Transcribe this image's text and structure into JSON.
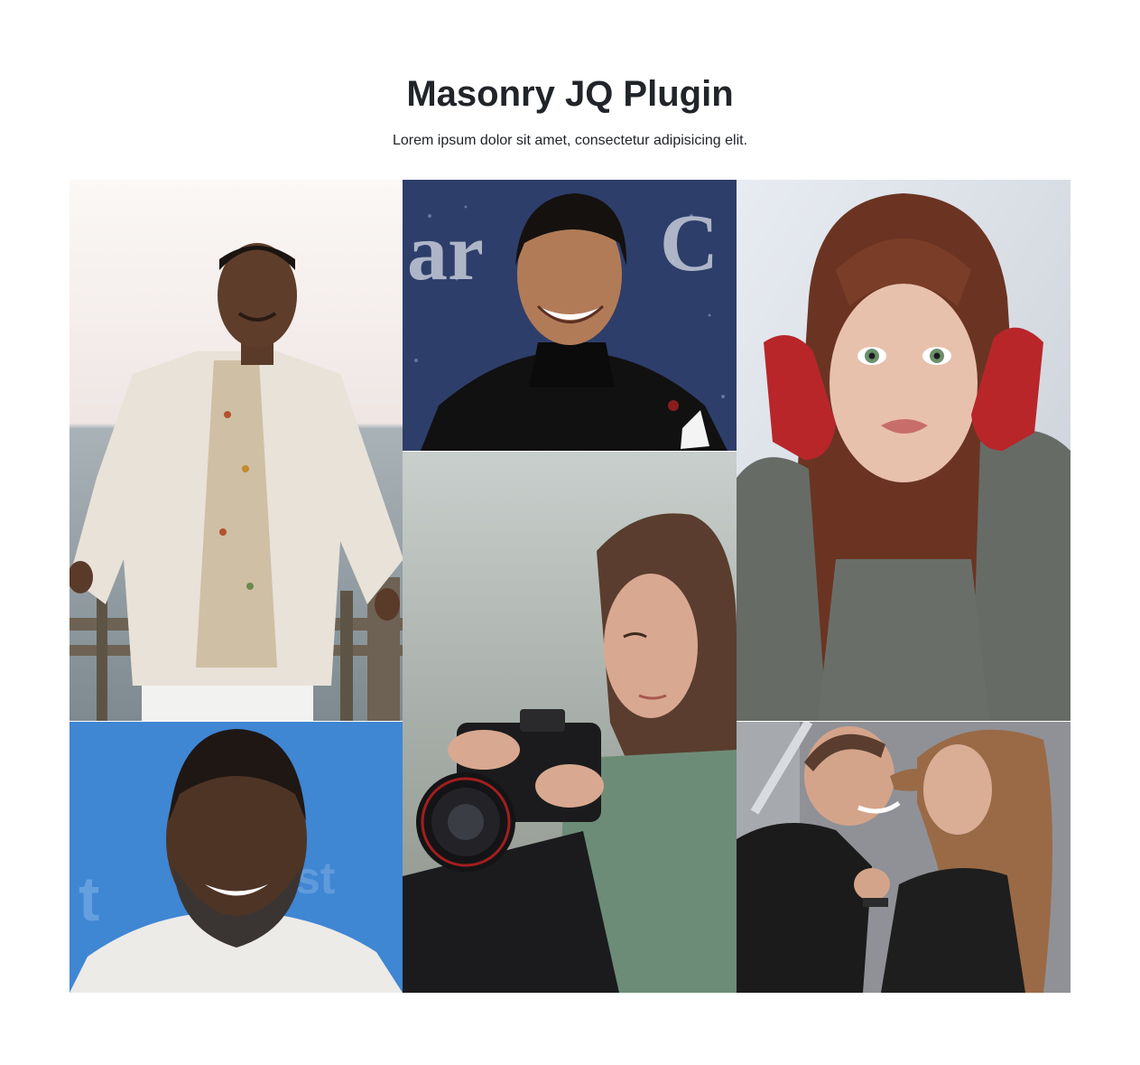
{
  "header": {
    "title": "Masonry JQ Plugin",
    "subtitle": "Lorem ipsum dolor sit amet, consectetur adipisicing elit."
  },
  "gallery": {
    "items": [
      {
        "name": "photo-man-white-suit",
        "palette": {
          "bg": "#e9e4e2",
          "sea": "#8e9aa1",
          "skin": "#5a3a29",
          "suit": "#e8e2d8",
          "shirt": "#c9b89e",
          "fence": "#6d6253"
        }
      },
      {
        "name": "photo-man-black-turtleneck",
        "palette": {
          "bg": "#2f3f6c",
          "skin": "#b07a56",
          "hair": "#1a1512",
          "jacket": "#121212"
        }
      },
      {
        "name": "photo-girl-red-gloves",
        "palette": {
          "bg": "#dfe3ea",
          "hair": "#6b3422",
          "skin": "#e8c1ad",
          "glove": "#b8262a",
          "sweater": "#6a6e68"
        }
      },
      {
        "name": "photo-man-blue-backdrop",
        "palette": {
          "bg": "#3f86d3",
          "skin": "#4e3425",
          "beard": "#3a3533",
          "shirt": "#ecebe7"
        }
      },
      {
        "name": "photo-woman-camera",
        "palette": {
          "bg": "#aab0ad",
          "hair": "#5a3d2e",
          "skin": "#d9a890",
          "camera": "#1b1b1d",
          "shirt": "#6d8c78"
        }
      },
      {
        "name": "photo-couple-hair-wind",
        "palette": {
          "bg": "#8a8c90",
          "skin": "#d4a48a",
          "hair": "#9a6a46",
          "shirt": "#1b1b1b"
        }
      }
    ]
  }
}
